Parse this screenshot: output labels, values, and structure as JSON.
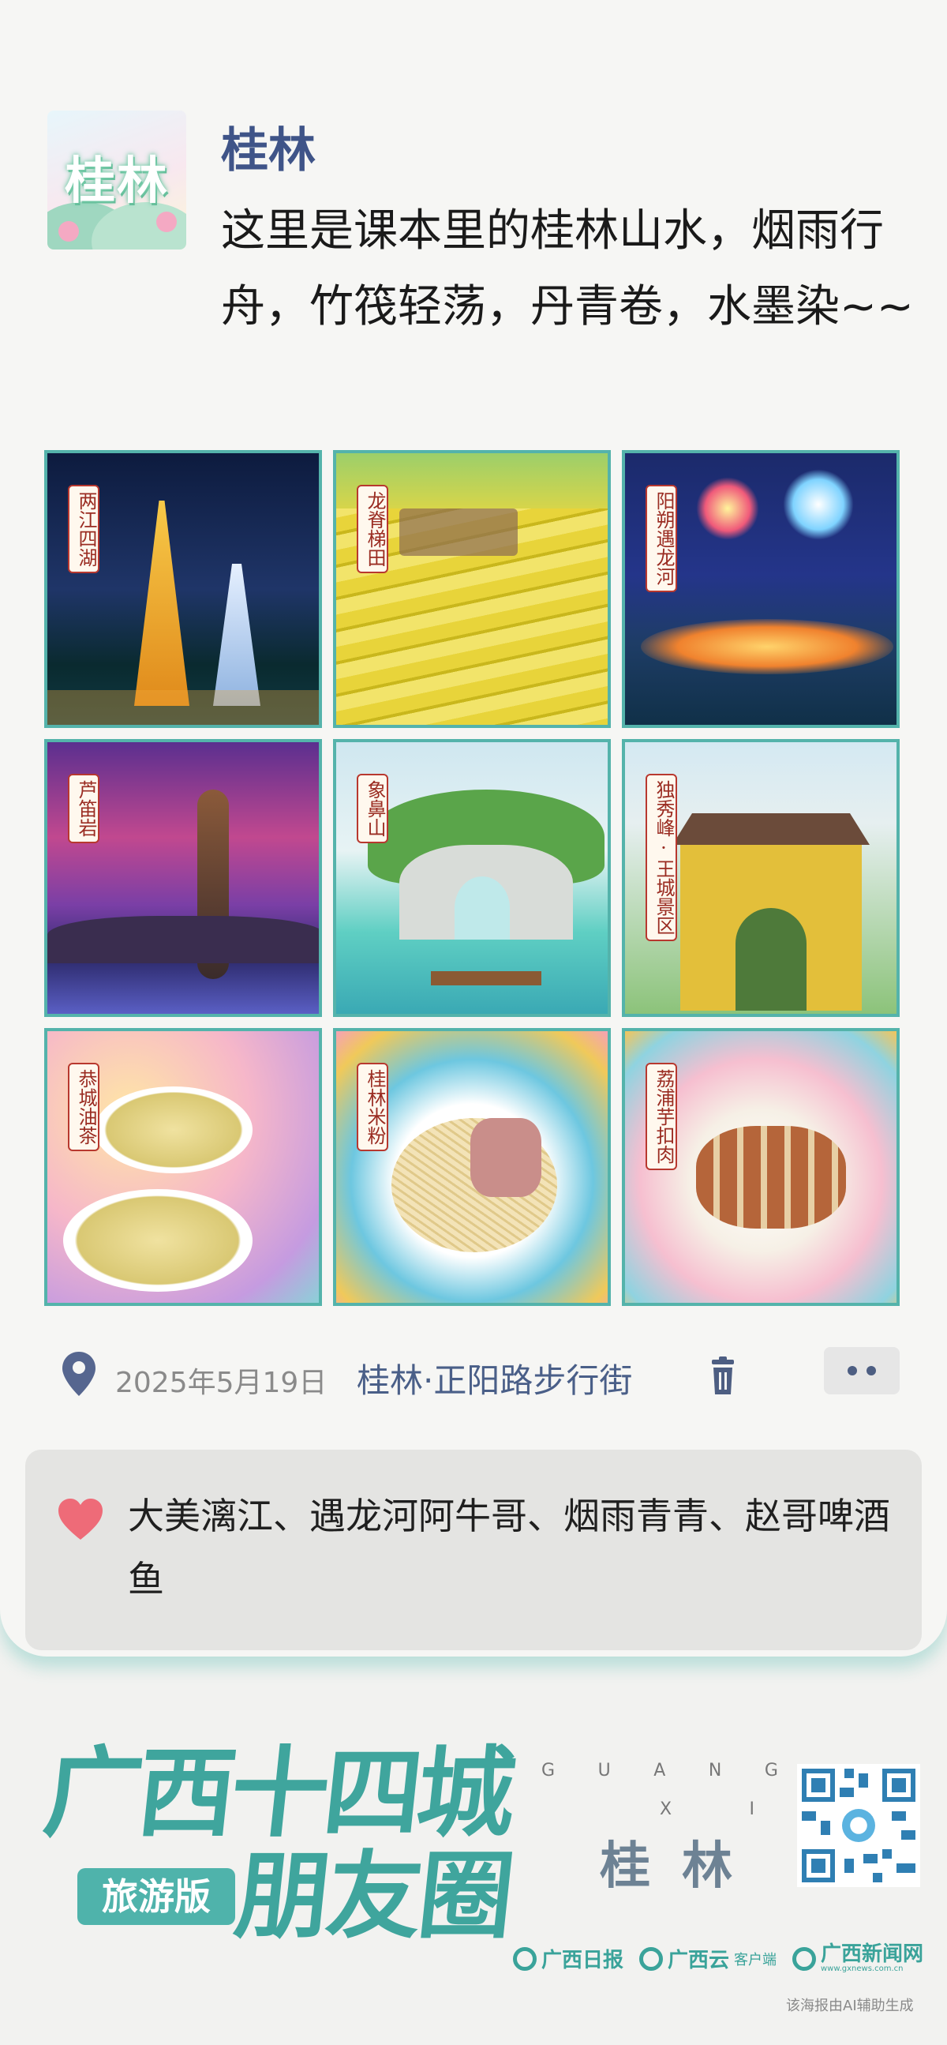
{
  "post": {
    "avatar_text": "桂林",
    "username": "桂林",
    "text": "这里是课本里的桂林山水，烟雨行舟，竹筏轻荡，丹青卷，水墨染~~"
  },
  "photos": [
    {
      "label": "两江四湖",
      "icon": "night-pagoda-painting"
    },
    {
      "label": "龙脊梯田",
      "icon": "rice-terrace-painting"
    },
    {
      "label": "阳朔遇龙河",
      "icon": "fireworks-river-painting"
    },
    {
      "label": "芦笛岩",
      "icon": "cave-painting"
    },
    {
      "label": "象鼻山",
      "icon": "elephant-trunk-hill-painting"
    },
    {
      "label": "独秀峰·王城景区",
      "icon": "city-gate-painting"
    },
    {
      "label": "恭城油茶",
      "icon": "oil-tea-painting"
    },
    {
      "label": "桂林米粉",
      "icon": "rice-noodle-painting"
    },
    {
      "label": "荔浦芋扣肉",
      "icon": "taro-pork-painting"
    }
  ],
  "meta": {
    "date": "2025年5月19日",
    "location": "桂林·正阳路步行街"
  },
  "likes": {
    "text": "大美漓江、遇龙河阿牛哥、烟雨青青、赵哥啤酒鱼"
  },
  "footer": {
    "brand_line1": "广西十四城",
    "brand_line2": "朋友圈",
    "edition": "旅游版",
    "letters_row1": [
      "G",
      "U",
      "A",
      "N",
      "G"
    ],
    "letters_row2": [
      "X",
      "I"
    ],
    "city": "桂林",
    "partners": [
      {
        "name": "广西日报",
        "sub": ""
      },
      {
        "name": "广西云",
        "sub": "客户端"
      },
      {
        "name": "广西新闻网",
        "sub": "www.gxnews.com.cn"
      }
    ],
    "disclaimer": "该海报由AI辅助生成"
  },
  "colors": {
    "accent": "#3fa59d",
    "username": "#3f5488",
    "heart": "#ee6b78",
    "label_border": "#b8382f"
  }
}
